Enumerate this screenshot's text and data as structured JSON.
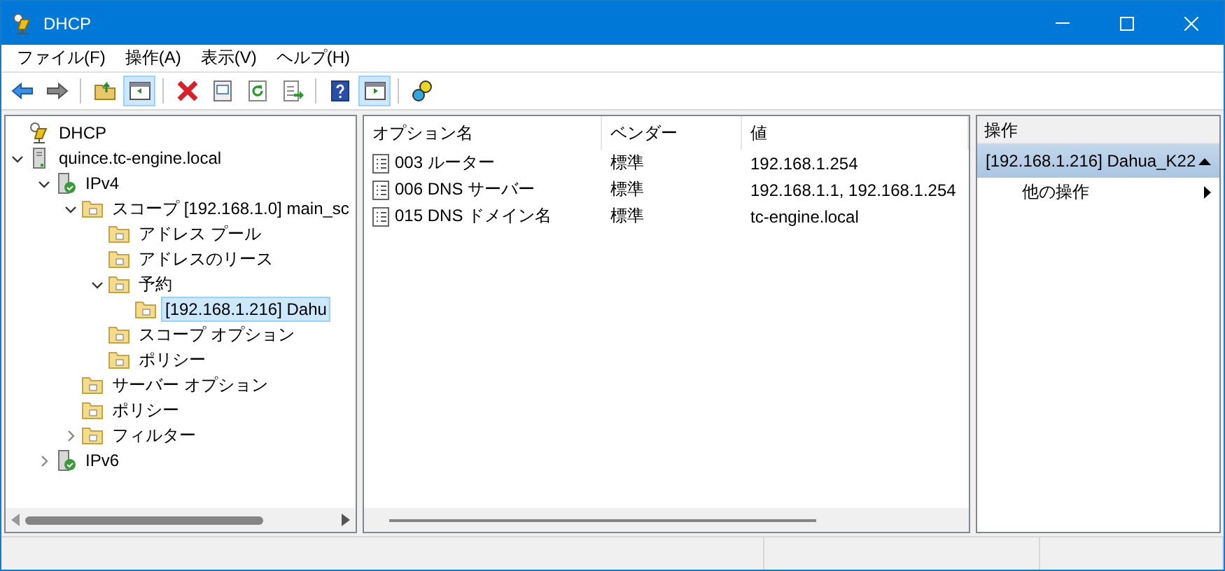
{
  "window": {
    "title": "DHCP"
  },
  "menu": [
    "ファイル(F)",
    "操作(A)",
    "表示(V)",
    "ヘルプ(H)"
  ],
  "toolbar": [
    {
      "kind": "button",
      "pressed": false
    },
    {
      "kind": "button",
      "pressed": false
    },
    {
      "kind": "separator"
    },
    {
      "kind": "button",
      "pressed": false
    },
    {
      "kind": "button",
      "pressed": true
    },
    {
      "kind": "separator"
    },
    {
      "kind": "button",
      "pressed": false
    },
    {
      "kind": "button",
      "pressed": false
    },
    {
      "kind": "button",
      "pressed": false
    },
    {
      "kind": "button",
      "pressed": false
    },
    {
      "kind": "separator"
    },
    {
      "kind": "button",
      "pressed": false
    },
    {
      "kind": "button",
      "pressed": true
    },
    {
      "kind": "separator"
    },
    {
      "kind": "button",
      "pressed": false
    }
  ],
  "tree": [
    {
      "label": "DHCP",
      "kind": "app",
      "selected": false,
      "children": [
        {
          "label": "quince.tc-engine.local",
          "kind": "server",
          "expanded": true,
          "selected": false,
          "children": [
            {
              "label": "IPv4",
              "kind": "protocol",
              "expanded": true,
              "selected": false,
              "children": [
                {
                  "label": "スコープ [192.168.1.0] main_sc",
                  "kind": "folder",
                  "expanded": true,
                  "selected": false,
                  "children": [
                    {
                      "label": "アドレス プール",
                      "kind": "folder",
                      "selected": false
                    },
                    {
                      "label": "アドレスのリース",
                      "kind": "folder",
                      "selected": false
                    },
                    {
                      "label": "予約",
                      "kind": "folder",
                      "expanded": true,
                      "selected": false,
                      "children": [
                        {
                          "label": "[192.168.1.216] Dahu",
                          "kind": "folder",
                          "selected": true
                        }
                      ]
                    },
                    {
                      "label": "スコープ オプション",
                      "kind": "folder",
                      "selected": false
                    },
                    {
                      "label": "ポリシー",
                      "kind": "folder",
                      "selected": false
                    }
                  ]
                },
                {
                  "label": "サーバー オプション",
                  "kind": "folder",
                  "selected": false
                },
                {
                  "label": "ポリシー",
                  "kind": "folder",
                  "selected": false
                },
                {
                  "label": "フィルター",
                  "kind": "folder",
                  "expanded": false,
                  "selected": false
                }
              ]
            },
            {
              "label": "IPv6",
              "kind": "protocol",
              "expanded": false,
              "selected": false
            }
          ]
        }
      ]
    }
  ],
  "table": {
    "columns": [
      "オプション名",
      "ベンダー",
      "値"
    ],
    "rows": [
      [
        "003 ルーター",
        "標準",
        "192.168.1.254"
      ],
      [
        "006 DNS サーバー",
        "標準",
        "192.168.1.1, 192.168.1.254"
      ],
      [
        "015 DNS ドメイン名",
        "標準",
        "tc-engine.local"
      ]
    ]
  },
  "actions": {
    "title": "操作",
    "section": "[192.168.1.216] Dahua_K22",
    "items": [
      "他の操作"
    ]
  }
}
